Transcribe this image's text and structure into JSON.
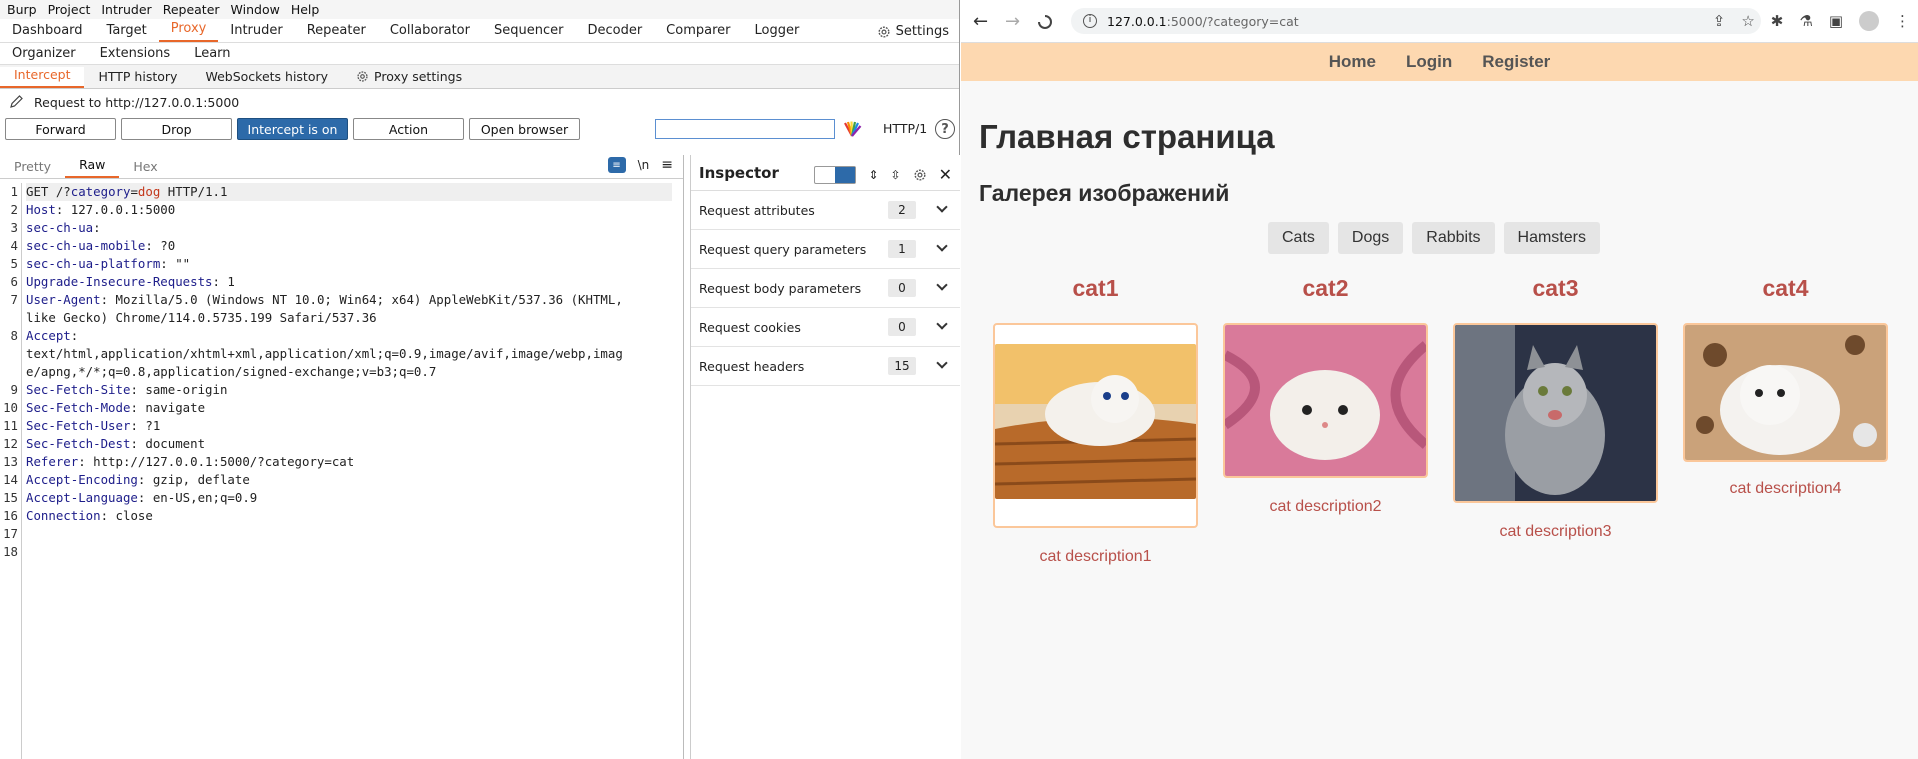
{
  "burp": {
    "menu": [
      "Burp",
      "Project",
      "Intruder",
      "Repeater",
      "Window",
      "Help"
    ],
    "top_tabs": [
      "Dashboard",
      "Target",
      "Proxy",
      "Intruder",
      "Repeater",
      "Collaborator",
      "Sequencer",
      "Decoder",
      "Comparer",
      "Logger"
    ],
    "settings_label": "Settings",
    "second_tabs": [
      "Organizer",
      "Extensions",
      "Learn"
    ],
    "proxy_tabs": [
      "Intercept",
      "HTTP history",
      "WebSockets history",
      "Proxy settings"
    ],
    "request_to": "Request to http://127.0.0.1:5000",
    "buttons": {
      "forward": "Forward",
      "drop": "Drop",
      "intercept": "Intercept is on",
      "action": "Action",
      "open_browser": "Open browser"
    },
    "http_version": "HTTP/1",
    "help": "?",
    "editor_tabs": [
      "Pretty",
      "Raw",
      "Hex"
    ],
    "newline_icon": "\\n",
    "request_lines": [
      {
        "n": "1"
      },
      {
        "n": "2"
      },
      {
        "n": "3"
      },
      {
        "n": "4"
      },
      {
        "n": "5"
      },
      {
        "n": "6"
      },
      {
        "n": "7"
      },
      {
        "n": ""
      },
      {
        "n": "8"
      },
      {
        "n": ""
      },
      {
        "n": ""
      },
      {
        "n": "9"
      },
      {
        "n": "10"
      },
      {
        "n": "11"
      },
      {
        "n": "12"
      },
      {
        "n": "13"
      },
      {
        "n": "14"
      },
      {
        "n": "15"
      },
      {
        "n": "16"
      },
      {
        "n": "17"
      },
      {
        "n": "18"
      }
    ],
    "request": {
      "l1_pre": "GET /?",
      "l1_param": "category",
      "l1_eq": "=",
      "l1_val": "dog",
      "l1_post": " HTTP/1.1",
      "headers": [
        {
          "k": "Host",
          "v": ": 127.0.0.1:5000"
        },
        {
          "k": "sec-ch-ua",
          "v": ":"
        },
        {
          "k": "sec-ch-ua-mobile",
          "v": ": ?0"
        },
        {
          "k": "sec-ch-ua-platform",
          "v": ": \"\""
        },
        {
          "k": "Upgrade-Insecure-Requests",
          "v": ": 1"
        },
        {
          "k": "User-Agent",
          "v": ": Mozilla/5.0 (Windows NT 10.0; Win64; x64) AppleWebKit/537.36 (KHTML,"
        },
        {
          "k": "",
          "v": "like Gecko) Chrome/114.0.5735.199 Safari/537.36"
        },
        {
          "k": "Accept",
          "v": ":"
        },
        {
          "k": "",
          "v": "text/html,application/xhtml+xml,application/xml;q=0.9,image/avif,image/webp,imag"
        },
        {
          "k": "",
          "v": "e/apng,*/*;q=0.8,application/signed-exchange;v=b3;q=0.7"
        },
        {
          "k": "Sec-Fetch-Site",
          "v": ": same-origin"
        },
        {
          "k": "Sec-Fetch-Mode",
          "v": ": navigate"
        },
        {
          "k": "Sec-Fetch-User",
          "v": ": ?1"
        },
        {
          "k": "Sec-Fetch-Dest",
          "v": ": document"
        },
        {
          "k": "Referer",
          "v": ": http://127.0.0.1:5000/?category=cat"
        },
        {
          "k": "Accept-Encoding",
          "v": ": gzip, deflate"
        },
        {
          "k": "Accept-Language",
          "v": ": en-US,en;q=0.9"
        },
        {
          "k": "Connection",
          "v": ": close"
        }
      ]
    },
    "inspector": {
      "title": "Inspector",
      "rows": [
        {
          "label": "Request attributes",
          "count": "2"
        },
        {
          "label": "Request query parameters",
          "count": "1"
        },
        {
          "label": "Request body parameters",
          "count": "0"
        },
        {
          "label": "Request cookies",
          "count": "0"
        },
        {
          "label": "Request headers",
          "count": "15"
        }
      ]
    }
  },
  "browser": {
    "url_host": "127.0.0.1",
    "url_path": ":5000/?category=cat",
    "site_nav": [
      "Home",
      "Login",
      "Register"
    ],
    "heading": "Главная страница",
    "subheading": "Галерея изображений",
    "categories": [
      "Cats",
      "Dogs",
      "Rabbits",
      "Hamsters"
    ],
    "cards": [
      {
        "title": "cat1",
        "desc": "cat description1"
      },
      {
        "title": "cat2",
        "desc": "cat description2"
      },
      {
        "title": "cat3",
        "desc": "cat description3"
      },
      {
        "title": "cat4",
        "desc": "cat description4"
      }
    ]
  },
  "colors": {
    "burp_accent": "#e8672a",
    "burp_primary": "#2d6aa9",
    "site_nav_bg": "#fdd8b0",
    "card_title": "#b8504a"
  }
}
